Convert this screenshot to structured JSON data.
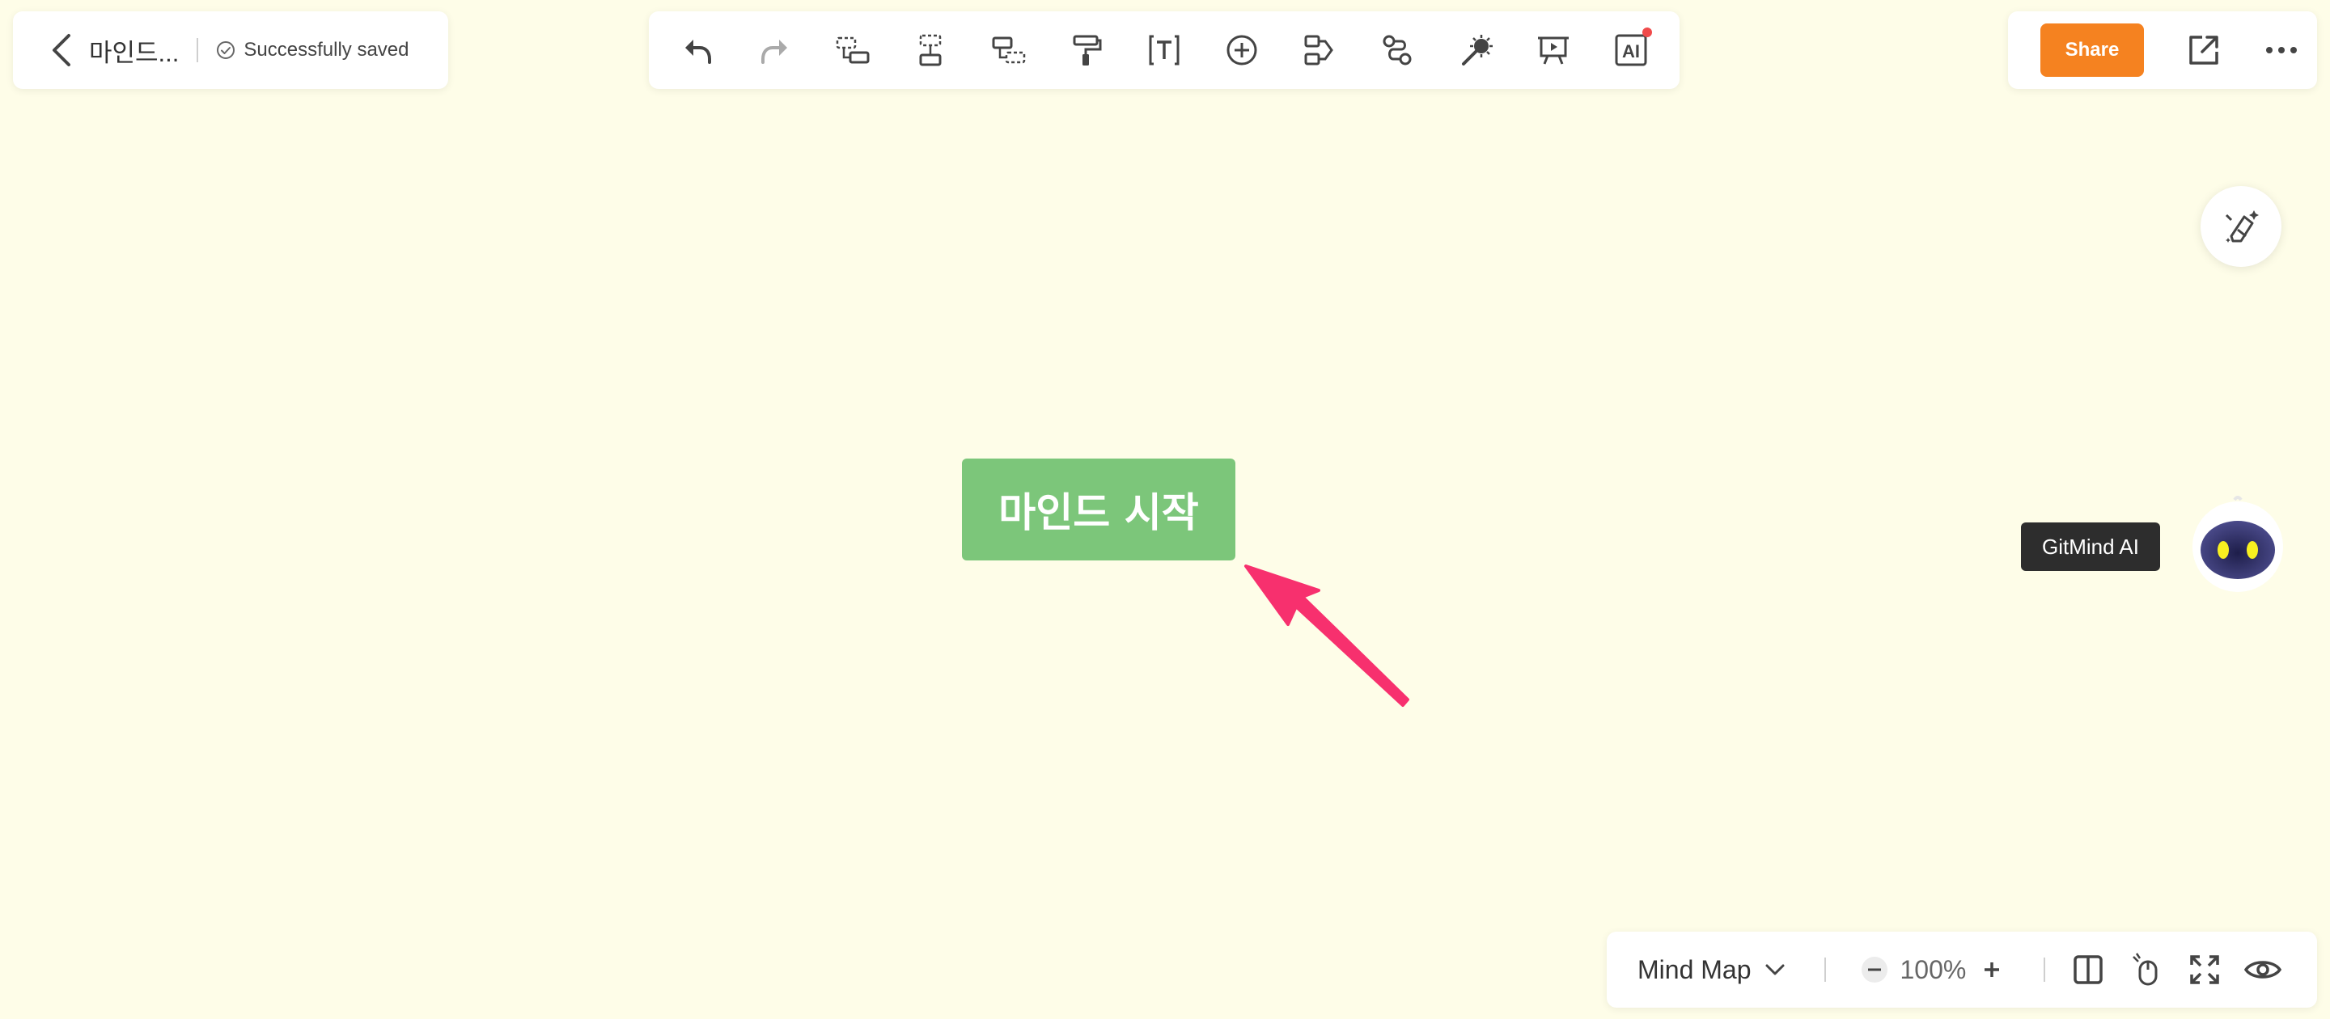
{
  "header": {
    "title": "마인드...",
    "save_status": "Successfully saved"
  },
  "toolbar": {
    "tools": [
      "undo-icon",
      "redo-icon",
      "subtopic-icon",
      "sibling-topic-icon",
      "parent-topic-icon",
      "format-painter-icon",
      "text-icon",
      "insert-icon",
      "layout-icon",
      "relationship-icon",
      "style-icon",
      "presentation-icon",
      "ai-icon"
    ],
    "ai_label": "AI"
  },
  "actions": {
    "share_label": "Share"
  },
  "assistant": {
    "tooltip": "GitMind AI"
  },
  "canvas": {
    "root_node_text": "마인드 시작"
  },
  "bottom_bar": {
    "view_mode": "Mind Map",
    "zoom": "100%"
  },
  "colors": {
    "background": "#fefde8",
    "accent": "#f58220",
    "node": "#7cc67a",
    "annotation_arrow": "#f7306e"
  }
}
